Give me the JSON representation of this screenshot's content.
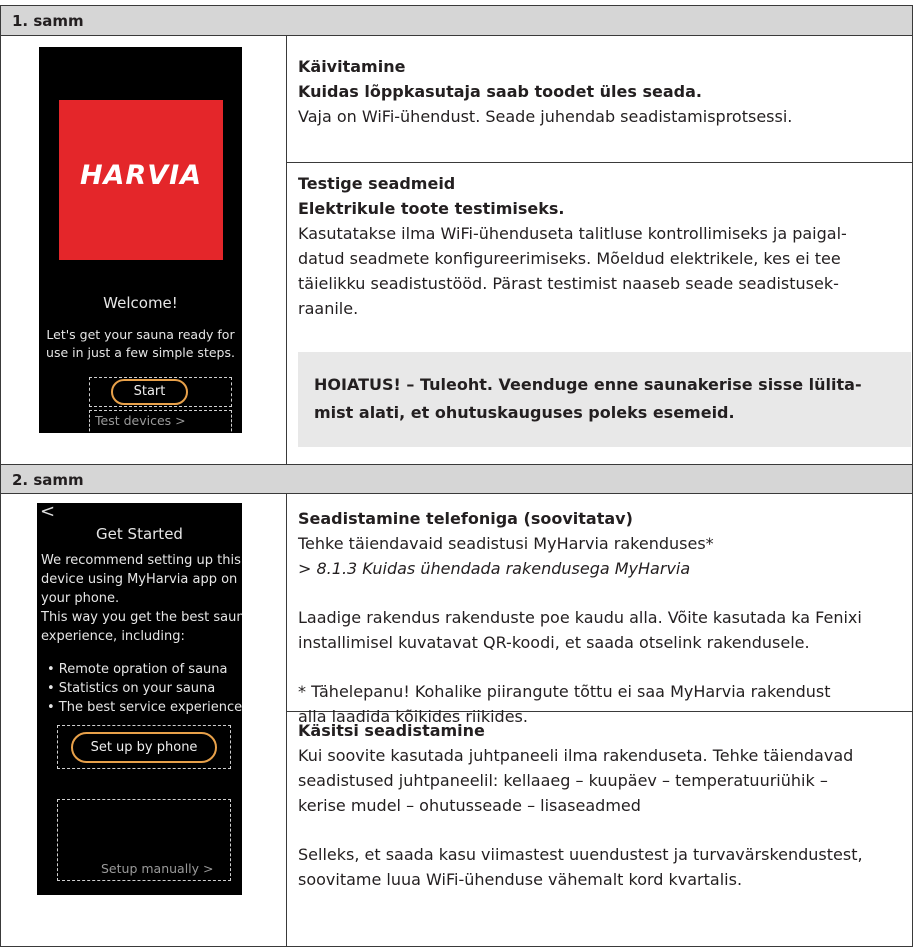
{
  "step1": {
    "header": "1. samm",
    "phone": {
      "logo": "HARVIA",
      "welcome": "Welcome!",
      "intro_line1": "Let's get your sauna ready for",
      "intro_line2": "use in just a few simple steps.",
      "start_button": "Start",
      "test_devices_link": "Test devices",
      "chevron": ">"
    },
    "section_a": {
      "title": "Käivitamine",
      "subtitle": "Kuidas lõppkasutaja saab toodet üles seada.",
      "body": "Vaja on WiFi-ühendust. Seade juhendab seadistamisprotsessi."
    },
    "section_b": {
      "title": "Testige seadmeid",
      "subtitle": "Elektrikule toote testimiseks.",
      "body_line1": "Kasutatakse ilma WiFi-ühenduseta talitluse kontrollimiseks ja paigal-",
      "body_line2": "datud seadmete konfigureerimiseks. Mõeldud elektrikele, kes ei tee",
      "body_line3": "täielikku seadistustööd. Pärast testimist naaseb seade seadistusek-",
      "body_line4": "raanile."
    },
    "warning": {
      "line1": "HOIATUS! – Tuleoht. Veenduge enne saunakerise sisse lülita-",
      "line2": "mist alati, et ohutuskauguses poleks esemeid."
    }
  },
  "step2": {
    "header": "2. samm",
    "phone": {
      "back": "<",
      "title": "Get Started",
      "lines": [
        "We recommend setting up this",
        "device using MyHarvia app on",
        "your phone.",
        "This way you get the best sauna",
        "experience, including:"
      ],
      "bullets": [
        "•  Remote opration of sauna",
        "•  Statistics on your sauna",
        "•  The best service experience"
      ],
      "phone_button": "Set up by phone",
      "manual_link": "Setup manually",
      "chevron": ">"
    },
    "section_a": {
      "title": "Seadistamine telefoniga (soovitatav)",
      "line1": "Tehke täiendavaid seadistusi MyHarvia rakenduses*",
      "ref": "> 8.1.3 Kuidas ühendada rakendusega MyHarvia",
      "para2_line1": "Laadige rakendus rakenduste poe kaudu alla. Võite kasutada ka Fenixi",
      "para2_line2": "installimisel kuvatavat QR-koodi, et saada otselink rakendusele.",
      "note_line1": "* Tähelepanu! Kohalike piirangute tõttu ei saa MyHarvia rakendust",
      "note_line2": "alla laadida kõikides riikides."
    },
    "section_b": {
      "title": "Käsitsi seadistamine",
      "line1": "Kui soovite kasutada juhtpaneeli ilma rakenduseta. Tehke täiendavad",
      "line2": "seadistused juhtpaneelil: kellaaeg – kuupäev – temperatuuriühik –",
      "line3": "kerise mudel – ohutusseade – lisaseadmed",
      "para2_line1": "Selleks, et saada kasu viimastest uuendustest ja turvavärskendustest,",
      "para2_line2": "soovitame luua WiFi-ühenduse vähemalt kord kvartalis."
    }
  }
}
